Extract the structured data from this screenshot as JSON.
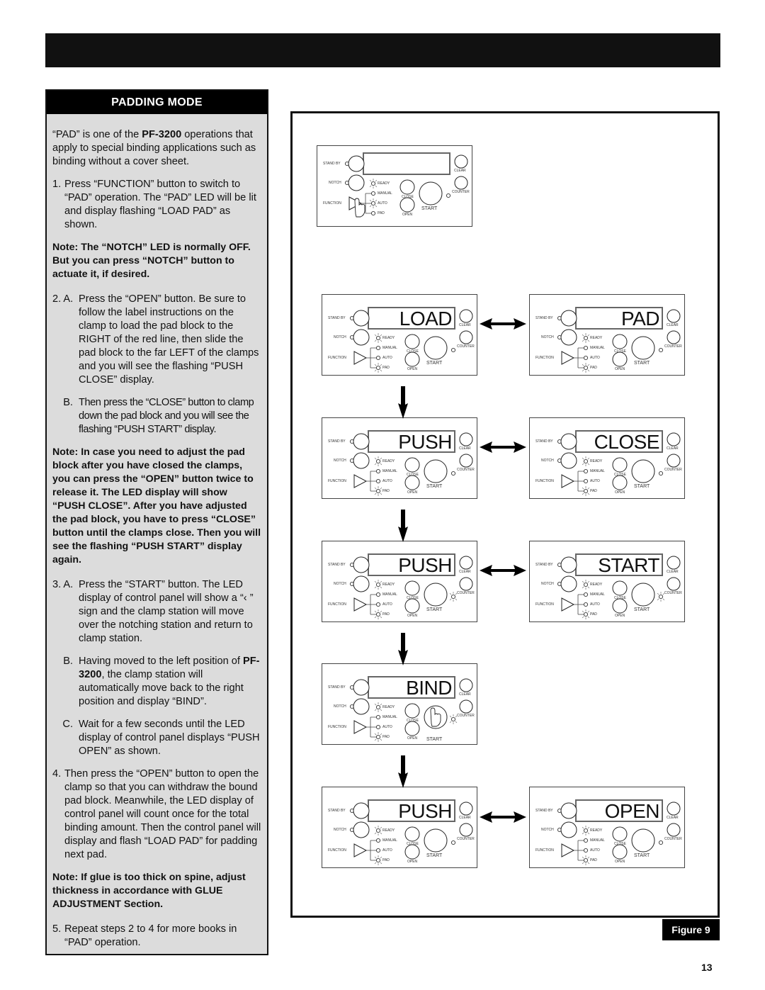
{
  "header": {
    "bar": ""
  },
  "sidebar": {
    "title": "PADDING MODE",
    "intro_pre": "“PAD” is one of the ",
    "intro_model": "PF-3200",
    "intro_post": " operations that apply to special binding applications such as binding without a cover sheet.",
    "step1_num": "1.",
    "step1_text": "Press “FUNCTION” button to switch to “PAD” operation. The “PAD” LED will be lit and display flashing “LOAD PAD” as shown.",
    "note1": "Note: The “NOTCH” LED is normally OFF. But you can press “NOTCH” button to actuate it, if desired.",
    "step2a_num": "2. A.",
    "step2a_text": "Press the “OPEN” button. Be sure to follow the label instructions on the clamp to load the pad block to the RIGHT of the red line, then slide the pad block to the far LEFT of the clamps and you will see the flashing “PUSH CLOSE” display.",
    "step2b_num": "B.",
    "step2b_text": "Then press the “CLOSE” button to clamp down the pad block and you will see the flashing “PUSH START” display.",
    "note2": "Note: In case you need to adjust the pad block after you have closed the clamps, you can press the “OPEN” button twice to release it. The LED display will show “PUSH CLOSE”. After you have adjusted the pad block, you have to press “CLOSE” button until the clamps close. Then you will see the flashing “PUSH START” display again.",
    "step3a_num": "3. A.",
    "step3a_text": "Press the “START” button. The LED display of control panel will show a “‹  ” sign and the clamp station will move over the notching station and return to clamp station.",
    "step3b_num": "B.",
    "step3b_pre": "Having moved to the left position of ",
    "step3b_model": "PF-3200",
    "step3b_post": ", the clamp station will automatically move back to the right position and display “BIND”.",
    "step3c_num": "C.",
    "step3c_text": "Wait for a few seconds until the LED display of control panel displays “PUSH OPEN” as shown.",
    "step4_num": "4.",
    "step4_text": "Then press the “OPEN” button to open the clamp so that you can withdraw the bound pad block. Meanwhile, the LED display of control panel will count once for the total binding amount. Then the control panel will display and flash “LOAD PAD” for padding next pad.",
    "note3": "Note: If glue is too thick on spine, adjust thickness in accordance with GLUE ADJUSTMENT Section.",
    "step5_num": "5.",
    "step5_text": "Repeat steps 2 to 4 for more books in “PAD” operation."
  },
  "panel_labels": {
    "stand_by": "STAND BY",
    "notch": "NOTCH",
    "function": "FUNCTION",
    "ready": "READY",
    "manual": "MANUAL",
    "auto": "AUTO",
    "pad": "PAD",
    "close": "CLOSE",
    "open": "OPEN",
    "clear": "CLEAR",
    "counter": "COUNTER",
    "start": "START"
  },
  "panels": [
    {
      "id": "initial",
      "display": "",
      "leds_lit": [
        "ready",
        "auto"
      ],
      "hand": "function"
    },
    {
      "id": "load",
      "display": "LOAD",
      "leds_lit": [
        "ready",
        "pad"
      ],
      "hand": ""
    },
    {
      "id": "pad",
      "display": "PAD",
      "leds_lit": [
        "ready",
        "pad"
      ],
      "hand": ""
    },
    {
      "id": "push-close",
      "display": "PUSH",
      "leds_lit": [
        "ready",
        "pad"
      ],
      "hand": ""
    },
    {
      "id": "close",
      "display": "CLOSE",
      "leds_lit": [
        "ready",
        "pad"
      ],
      "hand": ""
    },
    {
      "id": "push-start",
      "display": "PUSH",
      "leds_lit": [
        "ready",
        "pad",
        "counter"
      ],
      "hand": ""
    },
    {
      "id": "start",
      "display": "START",
      "leds_lit": [
        "ready",
        "pad",
        "counter"
      ],
      "hand": ""
    },
    {
      "id": "bind",
      "display": "BIND",
      "leds_lit": [
        "ready",
        "pad",
        "counter"
      ],
      "hand": "start"
    },
    {
      "id": "push-open",
      "display": "PUSH",
      "leds_lit": [
        "ready",
        "pad"
      ],
      "hand": ""
    },
    {
      "id": "open",
      "display": "OPEN",
      "leds_lit": [
        "ready",
        "pad"
      ],
      "hand": ""
    }
  ],
  "figure": {
    "label": "Figure 9"
  },
  "footer": {
    "page_number": "13"
  }
}
